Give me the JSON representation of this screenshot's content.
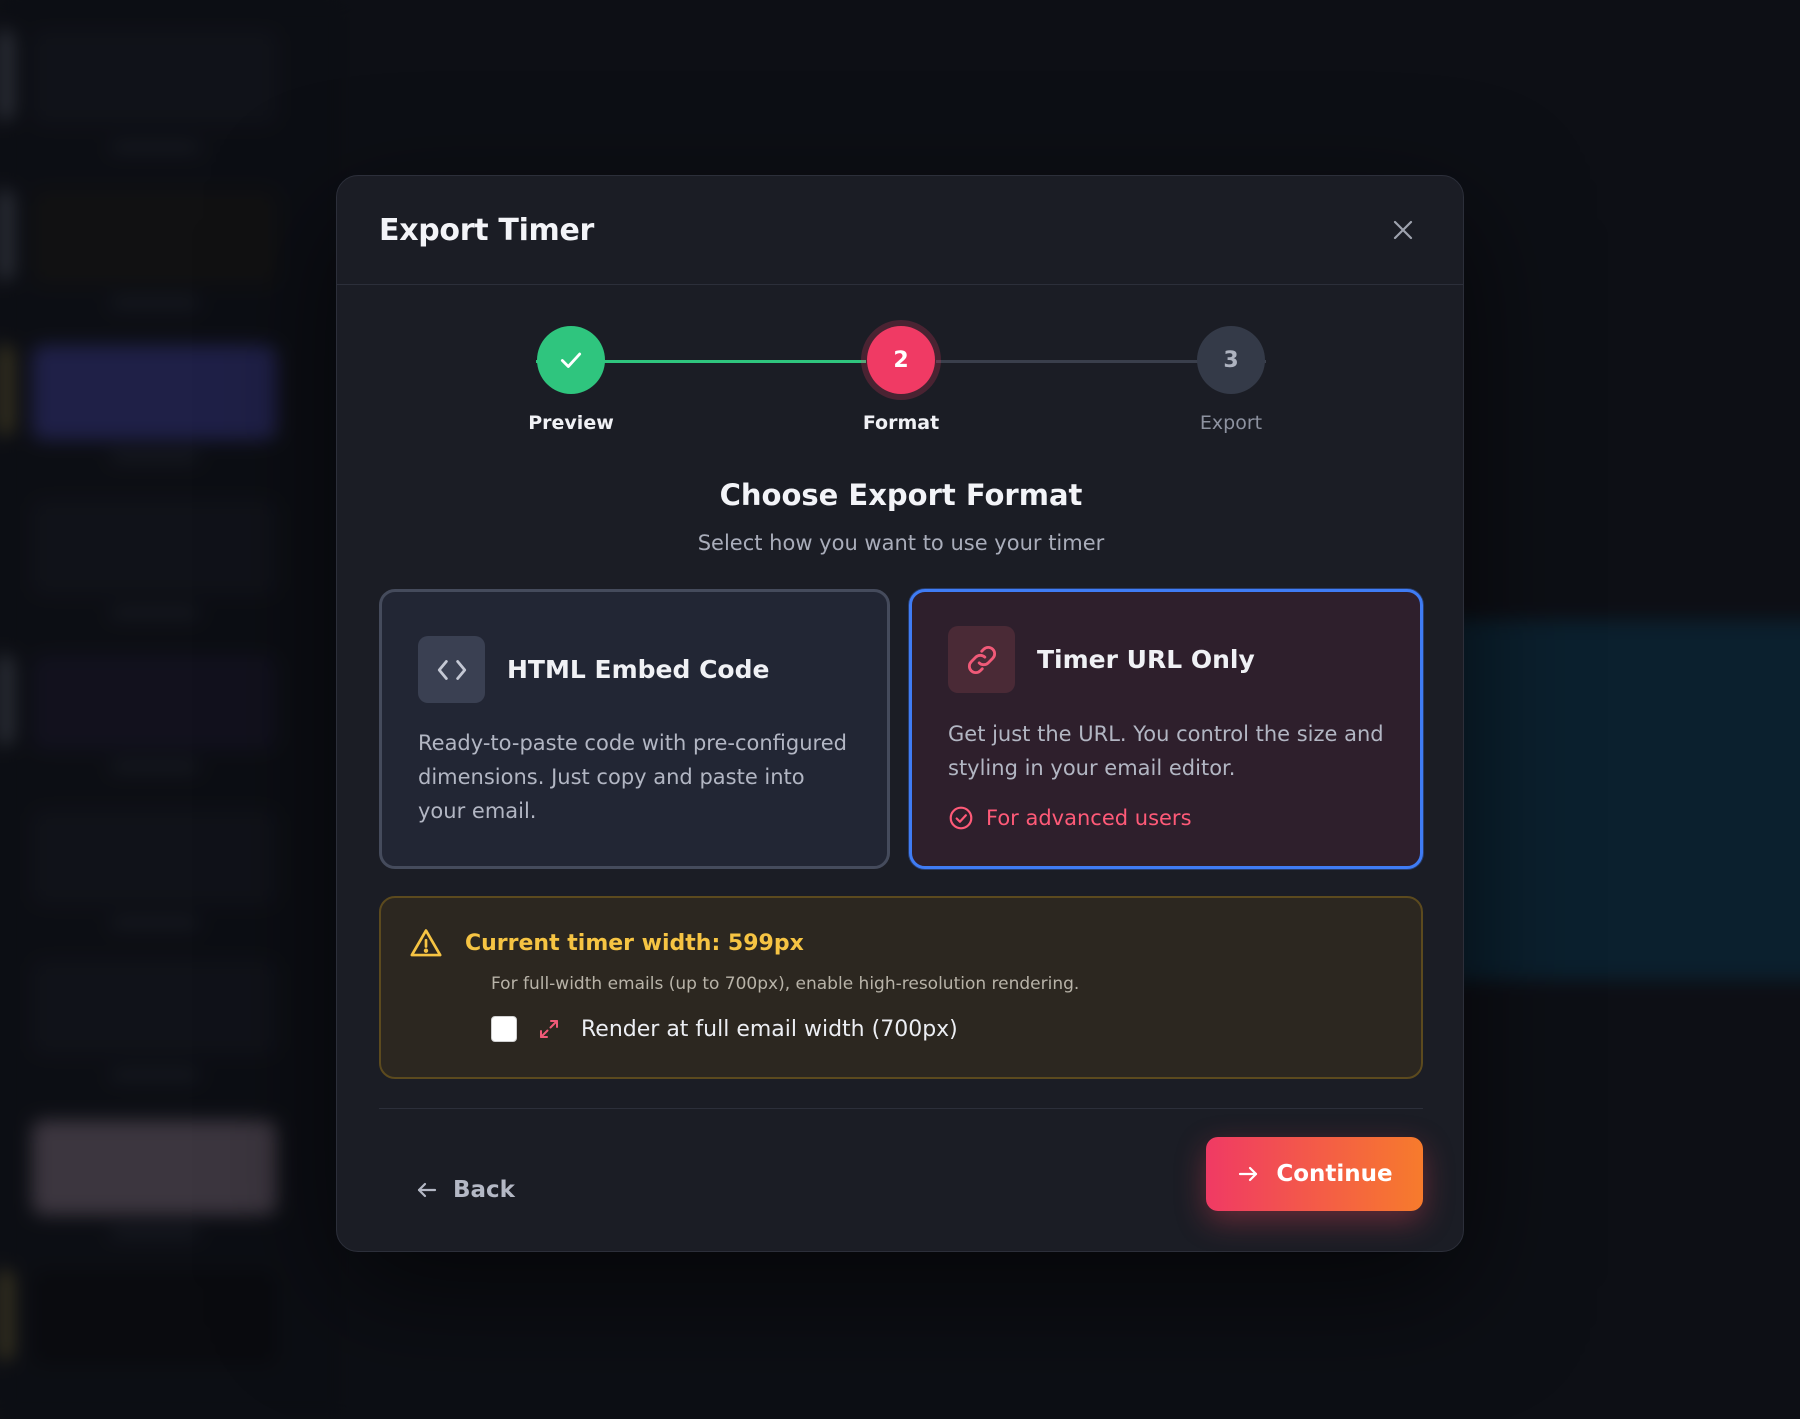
{
  "modal": {
    "title": "Export Timer"
  },
  "stepper": {
    "steps": [
      {
        "label": "Preview",
        "number": "",
        "state": "done"
      },
      {
        "label": "Format",
        "number": "2",
        "state": "active"
      },
      {
        "label": "Export",
        "number": "3",
        "state": "upcoming"
      }
    ]
  },
  "section": {
    "title": "Choose Export Format",
    "subtitle": "Select how you want to use your timer"
  },
  "options": {
    "html": {
      "title": "HTML Embed Code",
      "description": "Ready-to-paste code with pre-configured dimensions. Just copy and paste into your email.",
      "icon": "code-icon",
      "selected": false
    },
    "url": {
      "title": "Timer URL Only",
      "description": "Get just the URL. You control the size and styling in your email editor.",
      "tag": "For advanced users",
      "icon": "link-icon",
      "selected": true
    }
  },
  "warning": {
    "title": "Current timer width: 599px",
    "text": "For full-width emails (up to 700px), enable high-resolution rendering.",
    "checkbox_label": "Render at full email width (700px)",
    "checked": false
  },
  "footer": {
    "back_label": "Back",
    "continue_label": "Continue"
  },
  "colors": {
    "accent": "#f03a64",
    "success": "#2fc57e",
    "selected_border": "#3f7cf5",
    "warning": "#f6c443"
  }
}
